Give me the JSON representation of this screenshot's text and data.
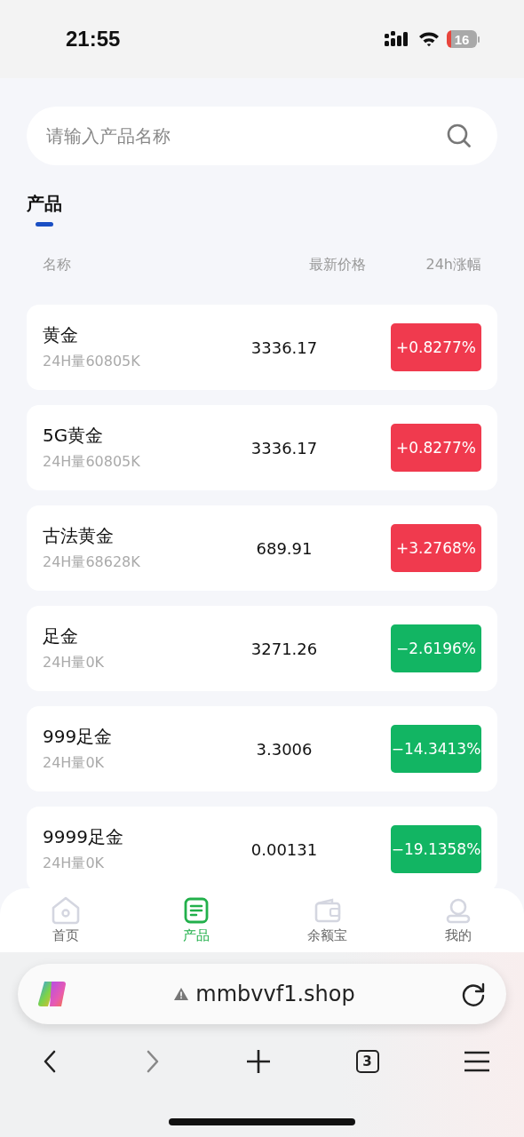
{
  "status_bar": {
    "time": "21:55",
    "battery": "16"
  },
  "search": {
    "placeholder": "请输入产品名称"
  },
  "tabs": [
    {
      "label": "产品",
      "selected": true
    }
  ],
  "table": {
    "columns": [
      "名称",
      "最新价格",
      "24h涨幅"
    ],
    "rows": [
      {
        "name": "黄金",
        "volume": "24H量60805K",
        "price": "3336.17",
        "change": "+0.8277%",
        "kind": "up"
      },
      {
        "name": "5G黄金",
        "volume": "24H量60805K",
        "price": "3336.17",
        "change": "+0.8277%",
        "kind": "up"
      },
      {
        "name": "古法黄金",
        "volume": "24H量68628K",
        "price": "689.91",
        "change": "+3.2768%",
        "kind": "up"
      },
      {
        "name": "足金",
        "volume": "24H量0K",
        "price": "3271.26",
        "change": "−2.6196%",
        "kind": "down"
      },
      {
        "name": "999足金",
        "volume": "24H量0K",
        "price": "3.3006",
        "change": "−14.3413%",
        "kind": "down"
      },
      {
        "name": "9999足金",
        "volume": "24H量0K",
        "price": "0.00131",
        "change": "−19.1358%",
        "kind": "down"
      }
    ]
  },
  "nav": [
    {
      "label": "首页",
      "kind": "home",
      "selected": false
    },
    {
      "label": "产品",
      "kind": "list",
      "selected": true
    },
    {
      "label": "余额宝",
      "kind": "wallet",
      "selected": false
    },
    {
      "label": "我的",
      "kind": "user",
      "selected": false
    }
  ],
  "browser": {
    "url": "mmbvvf1.shop",
    "tab_count": "3"
  }
}
